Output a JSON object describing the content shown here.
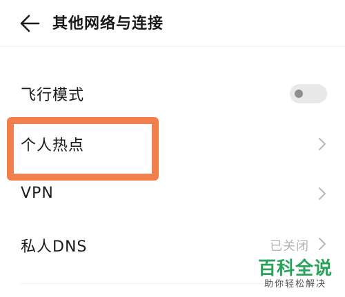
{
  "header": {
    "title": "其他网络与连接"
  },
  "settings": [
    {
      "label": "飞行模式",
      "control": "toggle",
      "enabled": false
    },
    {
      "label": "个人热点",
      "control": "chevron"
    },
    {
      "label": "VPN",
      "control": "chevron"
    },
    {
      "label": "私人DNS",
      "value": "已关闭",
      "control": "chevron"
    }
  ],
  "watermark": {
    "title": "百科全说",
    "subtitle": "助你轻松解决"
  },
  "colors": {
    "highlight": "#f2804c",
    "watermark_green": "#2aa35a",
    "secondary_text": "#b5b5b5"
  }
}
